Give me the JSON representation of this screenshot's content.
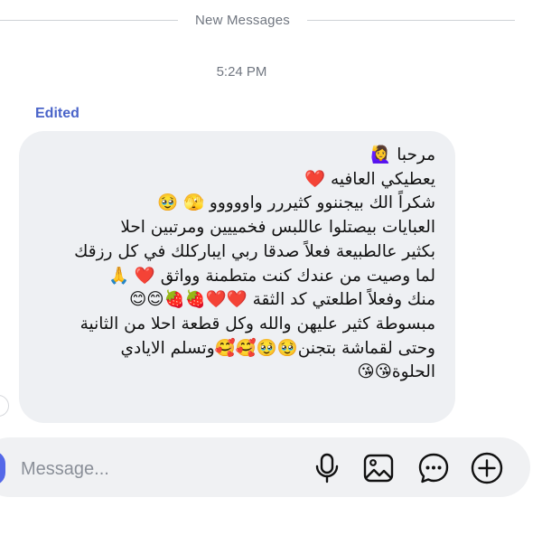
{
  "thread": {
    "divider_label": "New Messages",
    "timestamp": "5:24 PM",
    "edited_label": "Edited"
  },
  "message": {
    "lines": [
      "مرحبا 🙋‍♀️",
      "يعطيكي العافيه ❤️",
      "شكراً الك بيجننوو كثيررر  واووووو 🫣 🥹",
      "العبايات بيصتلوا عاللبس فخمييين ومرتبين احلا",
      "بكثير عالطبيعة فعلاً صدقا ربي ايباركلك في كل رزقك",
      "لما وصيت من عندك كنت متطمنة وواثق ❤️ 🙏",
      "منك وفعلاً اطلعتي كد الثقة ❤️❤️🍓🍓😊😊",
      "مبسوطة كثير عليهن والله وكل قطعة احلا من الثانية",
      "وحتى لقماشة بتجنن🥹🥹🥰🥰وتسلم الايادي",
      "الحلوة😘😘"
    ]
  },
  "composer": {
    "placeholder": "Message..."
  },
  "icons": {
    "mic": "microphone-icon",
    "gallery": "image-gallery-icon",
    "sticker": "sticker-icon",
    "add": "plus-icon"
  },
  "colors": {
    "accent": "#4a64c9",
    "bubble": "#eef0f3",
    "composer_bg": "#f0f1f3",
    "avatar": "#5468e8"
  }
}
